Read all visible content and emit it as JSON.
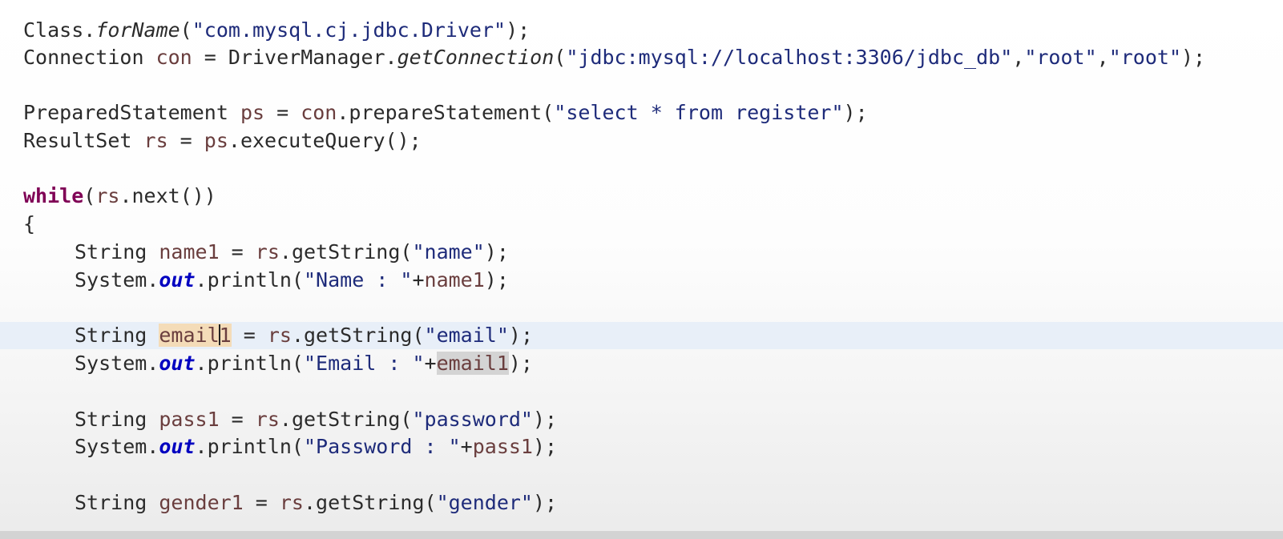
{
  "editor": {
    "lines": [
      {
        "indent": false,
        "current": false,
        "tokens": [
          {
            "text": "Class.",
            "style": "plain"
          },
          {
            "text": "forName",
            "style": "method-italic"
          },
          {
            "text": "(",
            "style": "plain"
          },
          {
            "text": "\"com.mysql.cj.jdbc.Driver\"",
            "style": "str-dark"
          },
          {
            "text": ");",
            "style": "plain"
          }
        ]
      },
      {
        "indent": false,
        "current": false,
        "tokens": [
          {
            "text": "Connection ",
            "style": "plain"
          },
          {
            "text": "con",
            "style": "var"
          },
          {
            "text": " = DriverManager.",
            "style": "plain"
          },
          {
            "text": "getConnection",
            "style": "method-italic"
          },
          {
            "text": "(",
            "style": "plain"
          },
          {
            "text": "\"jdbc:mysql://localhost:3306/jdbc_db\"",
            "style": "str-dark"
          },
          {
            "text": ",",
            "style": "plain"
          },
          {
            "text": "\"root\"",
            "style": "str-dark"
          },
          {
            "text": ",",
            "style": "plain"
          },
          {
            "text": "\"root\"",
            "style": "str-dark"
          },
          {
            "text": ");",
            "style": "plain"
          }
        ]
      },
      {
        "indent": false,
        "current": false,
        "tokens": []
      },
      {
        "indent": false,
        "current": false,
        "tokens": [
          {
            "text": "PreparedStatement ",
            "style": "plain"
          },
          {
            "text": "ps",
            "style": "var"
          },
          {
            "text": " = ",
            "style": "plain"
          },
          {
            "text": "con",
            "style": "var"
          },
          {
            "text": ".prepareStatement(",
            "style": "plain"
          },
          {
            "text": "\"select * from register\"",
            "style": "str-dark"
          },
          {
            "text": ");",
            "style": "plain"
          }
        ]
      },
      {
        "indent": false,
        "current": false,
        "tokens": [
          {
            "text": "ResultSet ",
            "style": "plain"
          },
          {
            "text": "rs",
            "style": "var"
          },
          {
            "text": " = ",
            "style": "plain"
          },
          {
            "text": "ps",
            "style": "var"
          },
          {
            "text": ".executeQuery();",
            "style": "plain"
          }
        ]
      },
      {
        "indent": false,
        "current": false,
        "tokens": []
      },
      {
        "indent": false,
        "current": false,
        "tokens": [
          {
            "text": "while",
            "style": "keyword"
          },
          {
            "text": "(",
            "style": "plain"
          },
          {
            "text": "rs",
            "style": "var"
          },
          {
            "text": ".next())",
            "style": "plain"
          }
        ]
      },
      {
        "indent": false,
        "current": false,
        "tokens": [
          {
            "text": "{",
            "style": "plain"
          }
        ]
      },
      {
        "indent": true,
        "current": false,
        "tokens": [
          {
            "text": "String ",
            "style": "plain"
          },
          {
            "text": "name1",
            "style": "var"
          },
          {
            "text": " = ",
            "style": "plain"
          },
          {
            "text": "rs",
            "style": "var"
          },
          {
            "text": ".getString(",
            "style": "plain"
          },
          {
            "text": "\"name\"",
            "style": "str-dark"
          },
          {
            "text": ");",
            "style": "plain"
          }
        ]
      },
      {
        "indent": true,
        "current": false,
        "tokens": [
          {
            "text": "System.",
            "style": "plain"
          },
          {
            "text": "out",
            "style": "static-field"
          },
          {
            "text": ".println(",
            "style": "plain"
          },
          {
            "text": "\"Name : \"",
            "style": "str-dark"
          },
          {
            "text": "+",
            "style": "plain"
          },
          {
            "text": "name1",
            "style": "var"
          },
          {
            "text": ");",
            "style": "plain"
          }
        ]
      },
      {
        "indent": true,
        "current": false,
        "tokens": []
      },
      {
        "indent": true,
        "current": true,
        "tokens": [
          {
            "text": "String ",
            "style": "plain"
          },
          {
            "text": "email",
            "style": "occurrence"
          },
          {
            "text": "",
            "style": "caret"
          },
          {
            "text": "1",
            "style": "occurrence"
          },
          {
            "text": " = ",
            "style": "plain"
          },
          {
            "text": "rs",
            "style": "var"
          },
          {
            "text": ".getString(",
            "style": "plain"
          },
          {
            "text": "\"email\"",
            "style": "str-dark"
          },
          {
            "text": ");",
            "style": "plain"
          }
        ]
      },
      {
        "indent": true,
        "current": false,
        "tokens": [
          {
            "text": "System.",
            "style": "plain"
          },
          {
            "text": "out",
            "style": "static-field"
          },
          {
            "text": ".println(",
            "style": "plain"
          },
          {
            "text": "\"Email : \"",
            "style": "str-dark"
          },
          {
            "text": "+",
            "style": "plain"
          },
          {
            "text": "email1",
            "style": "occurrence-read"
          },
          {
            "text": ");",
            "style": "plain"
          }
        ]
      },
      {
        "indent": true,
        "current": false,
        "tokens": []
      },
      {
        "indent": true,
        "current": false,
        "tokens": [
          {
            "text": "String ",
            "style": "plain"
          },
          {
            "text": "pass1",
            "style": "var"
          },
          {
            "text": " = ",
            "style": "plain"
          },
          {
            "text": "rs",
            "style": "var"
          },
          {
            "text": ".getString(",
            "style": "plain"
          },
          {
            "text": "\"password\"",
            "style": "str-dark"
          },
          {
            "text": ");",
            "style": "plain"
          }
        ]
      },
      {
        "indent": true,
        "current": false,
        "tokens": [
          {
            "text": "System.",
            "style": "plain"
          },
          {
            "text": "out",
            "style": "static-field"
          },
          {
            "text": ".println(",
            "style": "plain"
          },
          {
            "text": "\"Password : \"",
            "style": "str-dark"
          },
          {
            "text": "+",
            "style": "plain"
          },
          {
            "text": "pass1",
            "style": "var"
          },
          {
            "text": ");",
            "style": "plain"
          }
        ]
      },
      {
        "indent": true,
        "current": false,
        "tokens": []
      },
      {
        "indent": true,
        "current": false,
        "tokens": [
          {
            "text": "String ",
            "style": "plain"
          },
          {
            "text": "gender1",
            "style": "var"
          },
          {
            "text": " = ",
            "style": "plain"
          },
          {
            "text": "rs",
            "style": "var"
          },
          {
            "text": ".getString(",
            "style": "plain"
          },
          {
            "text": "\"gender\"",
            "style": "str-dark"
          },
          {
            "text": ");",
            "style": "plain"
          }
        ]
      }
    ]
  },
  "colors": {
    "current_line_highlight": "#e8eff8",
    "string_literal": "#1e2b7a",
    "keyword": "#7f0055",
    "static_field": "#0000c0",
    "local_variable": "#6a3e3e",
    "occurrence_write": "#f4dcb8",
    "occurrence_read": "#d4d4d4"
  }
}
